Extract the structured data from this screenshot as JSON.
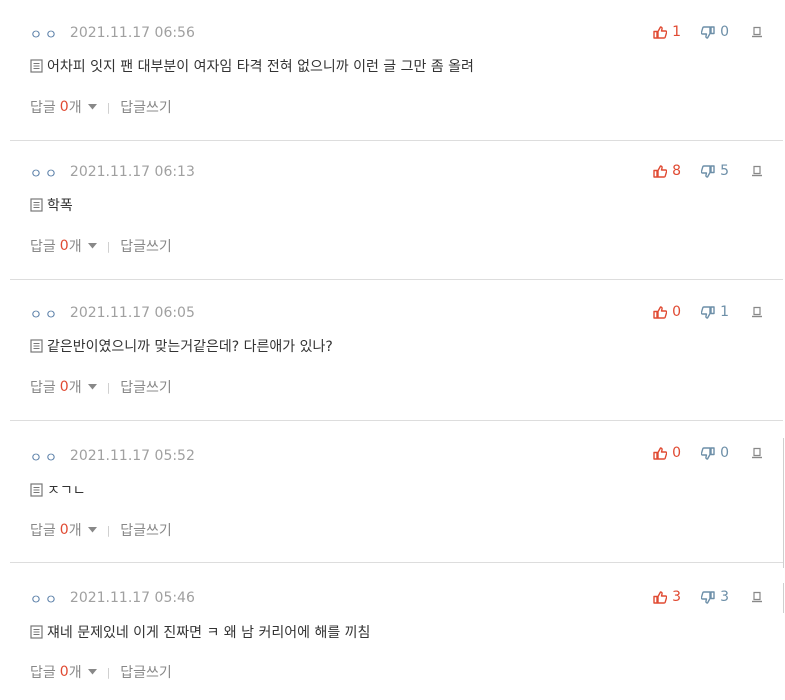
{
  "colors": {
    "upvote": "#e04a32",
    "downvote": "#6d8fa8",
    "author": "#5a7fa8",
    "meta_text": "#a0a0a0",
    "divider": "#dddddd"
  },
  "icons": {
    "upvote": "thumbs-up-icon",
    "downvote": "thumbs-down-icon",
    "report": "report-icon",
    "memo": "memo-icon",
    "caret": "caret-down-icon"
  },
  "labels": {
    "reply": "답글",
    "reply_count_suffix": "개",
    "separator": "|",
    "write_reply": "답글쓰기"
  },
  "comments": [
    {
      "author": "ㅇㅇ",
      "date": "2021.11.17 06:56",
      "upvotes": "1",
      "downvotes": "0",
      "text": "어차피 잇지 팬 대부분이 여자임 타격 전혀 없으니까 이런 글 그만 좀 올려",
      "reply_count": "0"
    },
    {
      "author": "ㅇㅇ",
      "date": "2021.11.17 06:13",
      "upvotes": "8",
      "downvotes": "5",
      "text": "학폭",
      "reply_count": "0"
    },
    {
      "author": "ㅇㅇ",
      "date": "2021.11.17 06:05",
      "upvotes": "0",
      "downvotes": "1",
      "text": "같은반이였으니까 맞는거같은데? 다른애가 있나?",
      "reply_count": "0"
    },
    {
      "author": "ㅇㅇ",
      "date": "2021.11.17 05:52",
      "upvotes": "0",
      "downvotes": "0",
      "text": "ㅈㄱㄴ",
      "reply_count": "0"
    },
    {
      "author": "ㅇㅇ",
      "date": "2021.11.17 05:46",
      "upvotes": "3",
      "downvotes": "3",
      "text": "쟤네 문제있네 이게 진짜면 ㅋ 왜 남 커리어에 해를 끼침",
      "reply_count": "0"
    }
  ]
}
